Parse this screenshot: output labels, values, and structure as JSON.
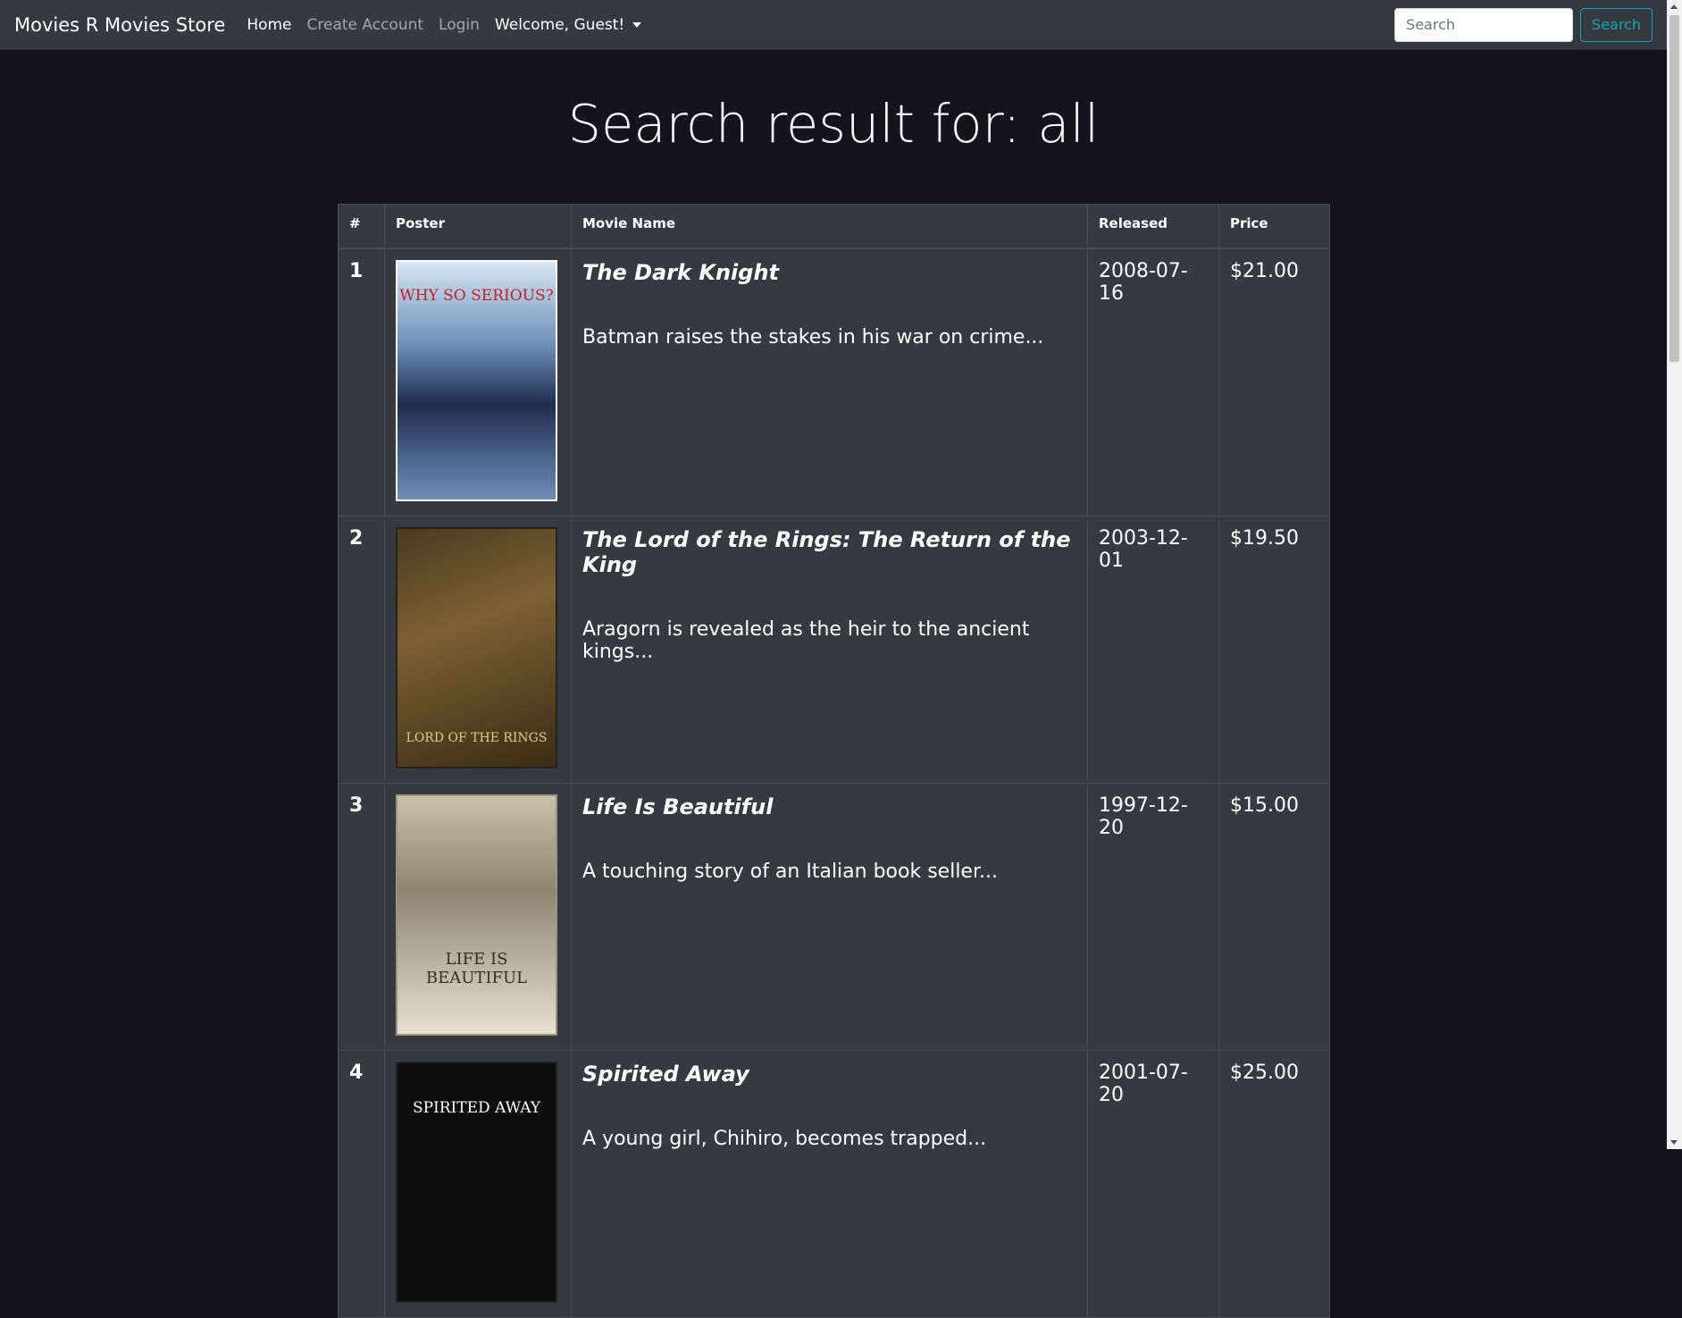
{
  "navbar": {
    "brand": "Movies R Movies Store",
    "links": [
      {
        "label": "Home"
      },
      {
        "label": "Create Account"
      },
      {
        "label": "Login"
      }
    ],
    "welcome": "Welcome, Guest!",
    "search_placeholder": "Search",
    "search_button": "Search"
  },
  "page": {
    "title": "Search result for: all"
  },
  "table": {
    "headers": [
      "#",
      "Poster",
      "Movie Name",
      "Released",
      "Price"
    ],
    "rows": [
      {
        "index": "1",
        "name": "The Dark Knight",
        "description": "Batman raises the stakes in his war on crime...",
        "released": "2008-07-16",
        "price": "$21.00",
        "poster_text": "WHY SO SERIOUS?"
      },
      {
        "index": "2",
        "name": "The Lord of the Rings: The Return of the King",
        "description": "Aragorn is revealed as the heir to the ancient kings...",
        "released": "2003-12-01",
        "price": "$19.50",
        "poster_text": "LORD OF THE RINGS"
      },
      {
        "index": "3",
        "name": "Life Is Beautiful",
        "description": "A touching story of an Italian book seller...",
        "released": "1997-12-20",
        "price": "$15.00",
        "poster_text": "LIFE IS BEAUTIFUL"
      },
      {
        "index": "4",
        "name": "Spirited Away",
        "description": "A young girl, Chihiro, becomes trapped...",
        "released": "2001-07-20",
        "price": "$25.00",
        "poster_text": "SPIRITED AWAY"
      }
    ]
  }
}
